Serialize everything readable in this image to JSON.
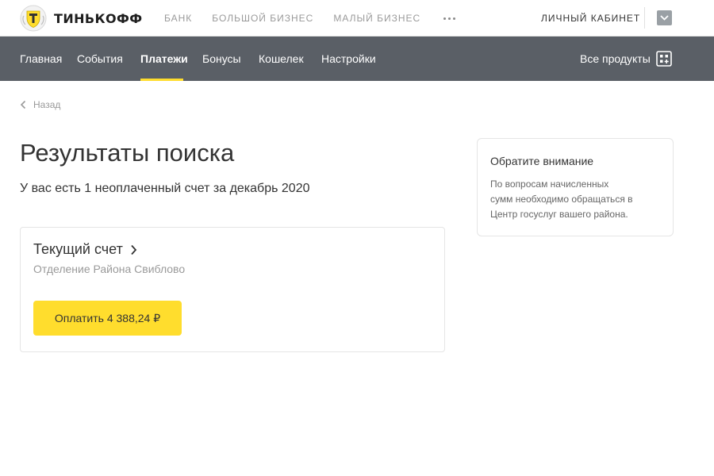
{
  "header": {
    "logo_text": "ТИНЬКОФФ",
    "nav": [
      "БАНК",
      "БОЛЬШОЙ БИЗНЕС",
      "МАЛЫЙ БИЗНЕС"
    ],
    "more_icon": "ellipsis-icon",
    "cabinet_label": "ЛИЧНЫЙ КАБИНЕТ",
    "user_menu_icon": "chevron-down-icon"
  },
  "main_nav": {
    "items": [
      "Главная",
      "События",
      "Платежи",
      "Бонусы",
      "Кошелек",
      "Настройки"
    ],
    "active": "Платежи",
    "all_products_label": "Все продукты",
    "all_products_icon": "apps-add-icon"
  },
  "page": {
    "back_label": "Назад",
    "title": "Результаты поиска",
    "subtitle": "У вас есть 1 неоплаченный счет за декабрь 2020"
  },
  "account_card": {
    "title": "Текущий счет",
    "subtitle": "Отделение Района Свиблово",
    "pay_button_label": "Оплатить 4 388,24 ₽"
  },
  "notice": {
    "title": "Обратите внимание",
    "text": "По вопросам начисленных\nсумм необходимо обращаться в\nЦентр госуслуг вашего района."
  },
  "colors": {
    "accent": "#ffdd2d",
    "nav_background": "#5a5f66",
    "text": "#333333",
    "muted_text": "#9a9a9a"
  }
}
